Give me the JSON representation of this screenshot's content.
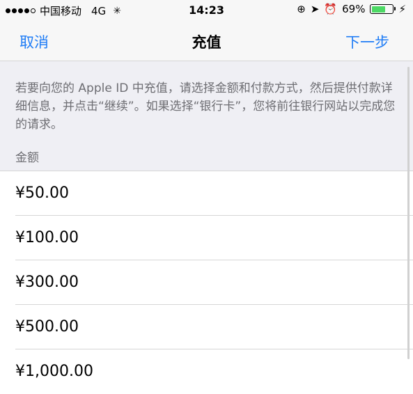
{
  "status_bar": {
    "carrier": "中国移动",
    "network": "4G",
    "spinner": "✳",
    "time": "14:23",
    "lock_icon": "⊕",
    "location_icon": "➤",
    "alarm_icon": "⏰",
    "battery_percent": "69%",
    "battery_level": 0.69,
    "charging_icon": "⚡"
  },
  "nav": {
    "cancel_label": "取消",
    "title": "充值",
    "next_label": "下一步"
  },
  "info": {
    "description": "若要向您的 Apple ID 中充值，请选择金额和付款方式，然后提供付款详细信息，并点击“继续”。如果选择“银行卡”，您将前往银行网站以完成您的请求。",
    "section_header": "金额"
  },
  "amounts": [
    {
      "label": "¥50.00"
    },
    {
      "label": "¥100.00"
    },
    {
      "label": "¥300.00"
    },
    {
      "label": "¥500.00"
    },
    {
      "label": "¥1,000.00"
    }
  ],
  "colors": {
    "accent": "#1e7cf6",
    "battery": "#4cd964",
    "group_background": "#efeff4"
  }
}
